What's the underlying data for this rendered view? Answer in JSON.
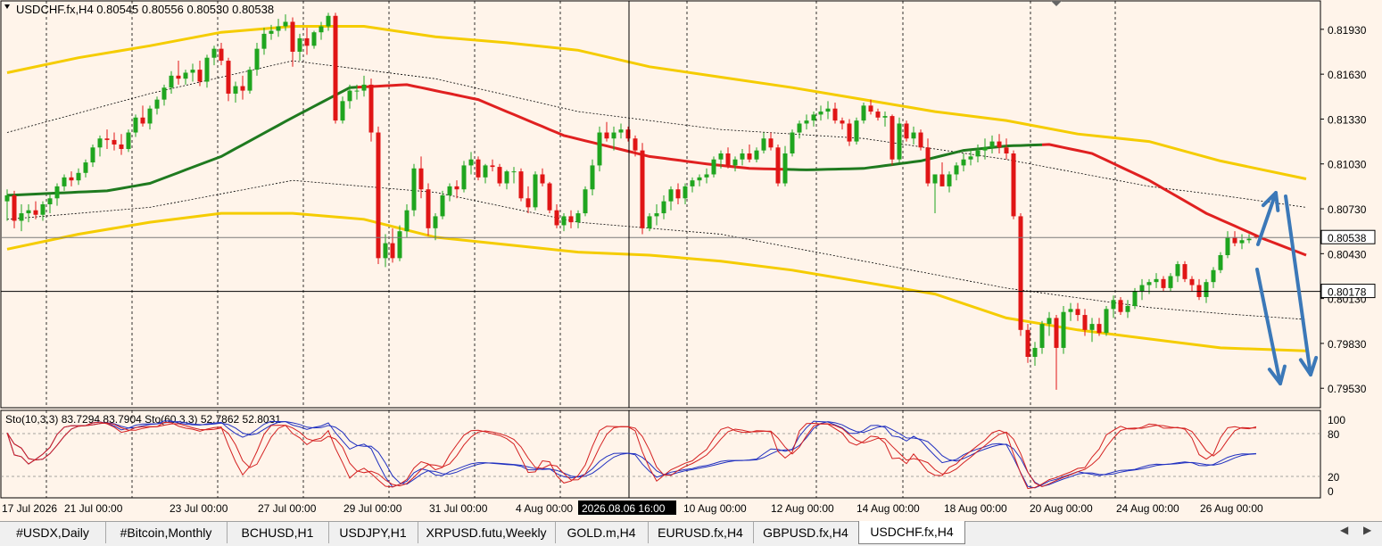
{
  "chart_data": {
    "type": "candlestick",
    "symbol_line": "USDCHF.fx,H4  0.80545 0.80556 0.80530 0.80538",
    "y_ticks": [
      "0.81930",
      "0.81630",
      "0.81330",
      "0.81030",
      "0.80730",
      "0.80430",
      "0.80130",
      "0.79830",
      "0.79530"
    ],
    "current_price_label": "0.80538",
    "crosshair_price_label": "0.80178",
    "x_ticks": [
      "17 Jul 2026",
      "21 Jul 00:00",
      "23 Jul 00:00",
      "27 Jul 00:00",
      "29 Jul 00:00",
      "31 Jul 00:00",
      "4 Aug 00:00",
      "10 Aug 00:00",
      "12 Aug 00:00",
      "14 Aug 00:00",
      "18 Aug 00:00",
      "20 Aug 00:00",
      "24 Aug 00:00",
      "26 Aug 00:00"
    ],
    "crosshair_time_label": "2026.08.06 16:00",
    "indicator_label": "Sto(10,3,3) 83.7294 83.7904  Sto(60,3,3) 52.7862 52.8031",
    "indicator_ticks": [
      "100",
      "80",
      "20",
      "0"
    ],
    "grid": true,
    "candles": [
      [
        0.8078,
        0.8086,
        0.8065,
        0.8082
      ],
      [
        0.8082,
        0.8085,
        0.806,
        0.8065
      ],
      [
        0.8065,
        0.8076,
        0.8058,
        0.807
      ],
      [
        0.807,
        0.8076,
        0.8064,
        0.8072
      ],
      [
        0.8072,
        0.8078,
        0.8066,
        0.8069
      ],
      [
        0.8069,
        0.8078,
        0.8065,
        0.8076
      ],
      [
        0.8076,
        0.8083,
        0.807,
        0.808
      ],
      [
        0.808,
        0.809,
        0.8075,
        0.8088
      ],
      [
        0.8088,
        0.8096,
        0.8085,
        0.8094
      ],
      [
        0.8094,
        0.8098,
        0.8088,
        0.8092
      ],
      [
        0.8092,
        0.81,
        0.8089,
        0.8097
      ],
      [
        0.8097,
        0.8106,
        0.8094,
        0.8104
      ],
      [
        0.8104,
        0.8116,
        0.8101,
        0.8114
      ],
      [
        0.8114,
        0.8122,
        0.8108,
        0.812
      ],
      [
        0.812,
        0.8126,
        0.8113,
        0.8119
      ],
      [
        0.8119,
        0.8124,
        0.8112,
        0.8116
      ],
      [
        0.8116,
        0.8123,
        0.8109,
        0.8113
      ],
      [
        0.8113,
        0.8126,
        0.8111,
        0.8124
      ],
      [
        0.8124,
        0.8136,
        0.8121,
        0.8134
      ],
      [
        0.8134,
        0.8142,
        0.8128,
        0.813
      ],
      [
        0.813,
        0.8142,
        0.8126,
        0.814
      ],
      [
        0.814,
        0.8148,
        0.8136,
        0.8146
      ],
      [
        0.8146,
        0.8156,
        0.8142,
        0.8154
      ],
      [
        0.8154,
        0.8165,
        0.815,
        0.8162
      ],
      [
        0.8162,
        0.8172,
        0.8156,
        0.816
      ],
      [
        0.816,
        0.8166,
        0.8156,
        0.8164
      ],
      [
        0.8164,
        0.817,
        0.8158,
        0.8166
      ],
      [
        0.8166,
        0.8172,
        0.8155,
        0.8158
      ],
      [
        0.8158,
        0.8176,
        0.8154,
        0.8174
      ],
      [
        0.8174,
        0.8182,
        0.8169,
        0.818
      ],
      [
        0.818,
        0.8184,
        0.8169,
        0.8172
      ],
      [
        0.8172,
        0.8174,
        0.8145,
        0.815
      ],
      [
        0.815,
        0.8158,
        0.8144,
        0.8155
      ],
      [
        0.8155,
        0.8162,
        0.8146,
        0.8152
      ],
      [
        0.8152,
        0.8168,
        0.815,
        0.8166
      ],
      [
        0.8166,
        0.8184,
        0.8162,
        0.818
      ],
      [
        0.818,
        0.8194,
        0.8176,
        0.819
      ],
      [
        0.819,
        0.8196,
        0.8186,
        0.8192
      ],
      [
        0.8192,
        0.82,
        0.8188,
        0.8195
      ],
      [
        0.8195,
        0.8203,
        0.8192,
        0.8198
      ],
      [
        0.8198,
        0.8201,
        0.8168,
        0.8178
      ],
      [
        0.8178,
        0.819,
        0.8172,
        0.8187
      ],
      [
        0.8187,
        0.8194,
        0.8176,
        0.8182
      ],
      [
        0.8182,
        0.8192,
        0.818,
        0.8191
      ],
      [
        0.8191,
        0.8198,
        0.8186,
        0.8195
      ],
      [
        0.8195,
        0.8204,
        0.8192,
        0.8202
      ],
      [
        0.8202,
        0.8204,
        0.813,
        0.8132
      ],
      [
        0.8132,
        0.8148,
        0.813,
        0.8145
      ],
      [
        0.8145,
        0.8156,
        0.814,
        0.8152
      ],
      [
        0.8152,
        0.8156,
        0.8146,
        0.8152
      ],
      [
        0.8152,
        0.8162,
        0.8148,
        0.8156
      ],
      [
        0.8156,
        0.816,
        0.8118,
        0.8124
      ],
      [
        0.8124,
        0.8128,
        0.8036,
        0.804
      ],
      [
        0.804,
        0.8056,
        0.8034,
        0.805
      ],
      [
        0.805,
        0.806,
        0.8037,
        0.804
      ],
      [
        0.804,
        0.8062,
        0.8038,
        0.8058
      ],
      [
        0.8058,
        0.8076,
        0.8054,
        0.8072
      ],
      [
        0.8072,
        0.8103,
        0.8068,
        0.81
      ],
      [
        0.81,
        0.8108,
        0.808,
        0.8086
      ],
      [
        0.8086,
        0.809,
        0.8055,
        0.806
      ],
      [
        0.806,
        0.807,
        0.8052,
        0.8068
      ],
      [
        0.8068,
        0.8085,
        0.8066,
        0.8082
      ],
      [
        0.8082,
        0.809,
        0.8078,
        0.8088
      ],
      [
        0.8088,
        0.8092,
        0.808,
        0.8086
      ],
      [
        0.8086,
        0.8105,
        0.8084,
        0.8102
      ],
      [
        0.8102,
        0.8111,
        0.8096,
        0.8106
      ],
      [
        0.8106,
        0.8108,
        0.8092,
        0.8094
      ],
      [
        0.8094,
        0.8103,
        0.809,
        0.8102
      ],
      [
        0.8102,
        0.8106,
        0.8098,
        0.8101
      ],
      [
        0.8101,
        0.8103,
        0.8088,
        0.809
      ],
      [
        0.809,
        0.8099,
        0.8086,
        0.8098
      ],
      [
        0.8098,
        0.8101,
        0.809,
        0.8098
      ],
      [
        0.8098,
        0.81,
        0.8078,
        0.808
      ],
      [
        0.808,
        0.8088,
        0.807,
        0.8074
      ],
      [
        0.8074,
        0.8098,
        0.8072,
        0.8096
      ],
      [
        0.8096,
        0.81,
        0.8088,
        0.809
      ],
      [
        0.809,
        0.8091,
        0.807,
        0.8072
      ],
      [
        0.8072,
        0.8076,
        0.806,
        0.8062
      ],
      [
        0.8062,
        0.807,
        0.8058,
        0.8068
      ],
      [
        0.8068,
        0.8072,
        0.806,
        0.8064
      ],
      [
        0.8064,
        0.8072,
        0.806,
        0.807
      ],
      [
        0.807,
        0.8088,
        0.8068,
        0.8086
      ],
      [
        0.8086,
        0.8106,
        0.8082,
        0.8102
      ],
      [
        0.8102,
        0.8128,
        0.8098,
        0.8124
      ],
      [
        0.8124,
        0.8131,
        0.8118,
        0.812
      ],
      [
        0.812,
        0.8128,
        0.8112,
        0.8124
      ],
      [
        0.8124,
        0.813,
        0.812,
        0.8126
      ],
      [
        0.8126,
        0.8128,
        0.8118,
        0.812
      ],
      [
        0.812,
        0.8122,
        0.8108,
        0.8112
      ],
      [
        0.8112,
        0.8117,
        0.8056,
        0.806
      ],
      [
        0.806,
        0.807,
        0.8058,
        0.8068
      ],
      [
        0.8068,
        0.8076,
        0.8062,
        0.807
      ],
      [
        0.807,
        0.8082,
        0.8066,
        0.8078
      ],
      [
        0.8078,
        0.8088,
        0.8072,
        0.8086
      ],
      [
        0.8086,
        0.809,
        0.8076,
        0.808
      ],
      [
        0.808,
        0.809,
        0.8076,
        0.8088
      ],
      [
        0.8088,
        0.8094,
        0.8084,
        0.8092
      ],
      [
        0.8092,
        0.8096,
        0.8088,
        0.8094
      ],
      [
        0.8094,
        0.81,
        0.809,
        0.8096
      ],
      [
        0.8096,
        0.8108,
        0.8094,
        0.8106
      ],
      [
        0.8106,
        0.8112,
        0.81,
        0.811
      ],
      [
        0.811,
        0.8114,
        0.81,
        0.8102
      ],
      [
        0.8102,
        0.8108,
        0.8098,
        0.8106
      ],
      [
        0.8106,
        0.8113,
        0.8102,
        0.811
      ],
      [
        0.811,
        0.8116,
        0.8104,
        0.8106
      ],
      [
        0.8106,
        0.8114,
        0.8104,
        0.8112
      ],
      [
        0.8112,
        0.8124,
        0.811,
        0.812
      ],
      [
        0.812,
        0.8124,
        0.8112,
        0.8114
      ],
      [
        0.8114,
        0.8116,
        0.8088,
        0.809
      ],
      [
        0.809,
        0.8115,
        0.8088,
        0.811
      ],
      [
        0.811,
        0.8126,
        0.8108,
        0.8124
      ],
      [
        0.8124,
        0.8132,
        0.812,
        0.813
      ],
      [
        0.813,
        0.8136,
        0.8126,
        0.8132
      ],
      [
        0.8132,
        0.8138,
        0.8128,
        0.8136
      ],
      [
        0.8136,
        0.8142,
        0.8132,
        0.8138
      ],
      [
        0.8138,
        0.8145,
        0.8133,
        0.814
      ],
      [
        0.814,
        0.8144,
        0.813,
        0.8132
      ],
      [
        0.8132,
        0.8134,
        0.8126,
        0.813
      ],
      [
        0.813,
        0.8133,
        0.8115,
        0.8118
      ],
      [
        0.8118,
        0.8134,
        0.8116,
        0.8132
      ],
      [
        0.8132,
        0.8144,
        0.813,
        0.8142
      ],
      [
        0.8142,
        0.8146,
        0.8136,
        0.8138
      ],
      [
        0.8138,
        0.814,
        0.8132,
        0.8134
      ],
      [
        0.8134,
        0.8138,
        0.8128,
        0.8135
      ],
      [
        0.8135,
        0.8136,
        0.8102,
        0.8106
      ],
      [
        0.8106,
        0.8134,
        0.8104,
        0.813
      ],
      [
        0.813,
        0.8132,
        0.8118,
        0.812
      ],
      [
        0.812,
        0.8128,
        0.8116,
        0.8124
      ],
      [
        0.8124,
        0.8126,
        0.8112,
        0.8114
      ],
      [
        0.8114,
        0.812,
        0.8088,
        0.809
      ],
      [
        0.809,
        0.8096,
        0.807,
        0.8096
      ],
      [
        0.8096,
        0.8104,
        0.8088,
        0.8088
      ],
      [
        0.8088,
        0.8098,
        0.8084,
        0.8096
      ],
      [
        0.8096,
        0.8104,
        0.8092,
        0.8102
      ],
      [
        0.8102,
        0.811,
        0.8098,
        0.8106
      ],
      [
        0.8106,
        0.8112,
        0.8102,
        0.8108
      ],
      [
        0.8108,
        0.8116,
        0.8104,
        0.8112
      ],
      [
        0.8112,
        0.812,
        0.8106,
        0.8114
      ],
      [
        0.8114,
        0.8122,
        0.811,
        0.8118
      ],
      [
        0.8118,
        0.8123,
        0.811,
        0.8114
      ],
      [
        0.8114,
        0.812,
        0.8106,
        0.811
      ],
      [
        0.811,
        0.8112,
        0.8066,
        0.8068
      ],
      [
        0.8068,
        0.807,
        0.7988,
        0.7992
      ],
      [
        0.7992,
        0.7996,
        0.797,
        0.7974
      ],
      [
        0.7974,
        0.7984,
        0.7968,
        0.798
      ],
      [
        0.798,
        0.7998,
        0.7976,
        0.7996
      ],
      [
        0.7996,
        0.8004,
        0.7988,
        0.8
      ],
      [
        0.8,
        0.8002,
        0.7952,
        0.798
      ],
      [
        0.798,
        0.8008,
        0.7976,
        0.8004
      ],
      [
        0.8004,
        0.801,
        0.7998,
        0.8006
      ],
      [
        0.8006,
        0.801,
        0.7998,
        0.8002
      ],
      [
        0.8002,
        0.8006,
        0.7988,
        0.7992
      ],
      [
        0.7992,
        0.8,
        0.7984,
        0.7996
      ],
      [
        0.7996,
        0.8,
        0.7988,
        0.799
      ],
      [
        0.799,
        0.8008,
        0.7988,
        0.8006
      ],
      [
        0.8006,
        0.8015,
        0.8,
        0.8012
      ],
      [
        0.8012,
        0.8014,
        0.8002,
        0.8004
      ],
      [
        0.8004,
        0.8012,
        0.8,
        0.8008
      ],
      [
        0.8008,
        0.802,
        0.8006,
        0.8018
      ],
      [
        0.8018,
        0.8026,
        0.8012,
        0.8022
      ],
      [
        0.8022,
        0.8026,
        0.8016,
        0.8024
      ],
      [
        0.8024,
        0.803,
        0.802,
        0.8026
      ],
      [
        0.8026,
        0.8028,
        0.8018,
        0.802
      ],
      [
        0.802,
        0.803,
        0.8018,
        0.8028
      ],
      [
        0.8028,
        0.8038,
        0.8024,
        0.8036
      ],
      [
        0.8036,
        0.8038,
        0.8024,
        0.8026
      ],
      [
        0.8026,
        0.8028,
        0.8018,
        0.8022
      ],
      [
        0.8022,
        0.8026,
        0.8012,
        0.8014
      ],
      [
        0.8014,
        0.8026,
        0.801,
        0.8024
      ],
      [
        0.8024,
        0.8034,
        0.802,
        0.8032
      ],
      [
        0.8032,
        0.8044,
        0.803,
        0.8042
      ],
      [
        0.8042,
        0.8058,
        0.804,
        0.8054
      ],
      [
        0.8054,
        0.8058,
        0.8048,
        0.805
      ],
      [
        0.805,
        0.8056,
        0.8046,
        0.8052
      ],
      [
        0.8052,
        0.8056,
        0.805,
        0.8053
      ],
      [
        0.80545,
        0.80556,
        0.8053,
        0.80538
      ]
    ],
    "ma_center": [
      [
        0,
        0.8082
      ],
      [
        14,
        0.8085
      ],
      [
        20,
        0.809
      ],
      [
        30,
        0.8108
      ],
      [
        40,
        0.8134
      ],
      [
        48,
        0.8154
      ],
      [
        56,
        0.8156
      ],
      [
        66,
        0.8146
      ],
      [
        78,
        0.8122
      ],
      [
        90,
        0.8108
      ],
      [
        98,
        0.8103
      ],
      [
        104,
        0.81
      ],
      [
        112,
        0.8099
      ],
      [
        120,
        0.81
      ],
      [
        128,
        0.8105
      ],
      [
        134,
        0.8112
      ],
      [
        140,
        0.8115
      ],
      [
        146,
        0.8116
      ],
      [
        152,
        0.811
      ],
      [
        160,
        0.8092
      ],
      [
        168,
        0.807
      ],
      [
        176,
        0.8053
      ],
      [
        182,
        0.8042
      ]
    ],
    "ma_center_colors": [
      [
        "#1F7A1F",
        0,
        49
      ],
      [
        "#E02020",
        49,
        109
      ],
      [
        "#1F7A1F",
        109,
        145
      ],
      [
        "#E02020",
        145,
        182
      ]
    ],
    "band_upper": [
      [
        0,
        0.8164
      ],
      [
        10,
        0.8174
      ],
      [
        20,
        0.8182
      ],
      [
        30,
        0.8191
      ],
      [
        40,
        0.8195
      ],
      [
        50,
        0.8195
      ],
      [
        60,
        0.8188
      ],
      [
        70,
        0.8184
      ],
      [
        80,
        0.8179
      ],
      [
        90,
        0.8168
      ],
      [
        100,
        0.8161
      ],
      [
        110,
        0.8154
      ],
      [
        120,
        0.8146
      ],
      [
        130,
        0.8138
      ],
      [
        140,
        0.8132
      ],
      [
        150,
        0.8123
      ],
      [
        160,
        0.8118
      ],
      [
        170,
        0.8105
      ],
      [
        182,
        0.8093
      ]
    ],
    "band_lower": [
      [
        0,
        0.8046
      ],
      [
        10,
        0.8056
      ],
      [
        20,
        0.8064
      ],
      [
        30,
        0.807
      ],
      [
        40,
        0.807
      ],
      [
        50,
        0.8066
      ],
      [
        60,
        0.8054
      ],
      [
        70,
        0.8049
      ],
      [
        80,
        0.8044
      ],
      [
        90,
        0.8042
      ],
      [
        100,
        0.8038
      ],
      [
        110,
        0.8032
      ],
      [
        120,
        0.8024
      ],
      [
        130,
        0.8016
      ],
      [
        140,
        0.8
      ],
      [
        150,
        0.7992
      ],
      [
        160,
        0.7986
      ],
      [
        170,
        0.798
      ],
      [
        182,
        0.7978
      ]
    ],
    "band_mid_upper": [
      [
        0,
        0.8124
      ],
      [
        20,
        0.815
      ],
      [
        40,
        0.8172
      ],
      [
        60,
        0.816
      ],
      [
        80,
        0.8138
      ],
      [
        100,
        0.8126
      ],
      [
        120,
        0.812
      ],
      [
        140,
        0.8106
      ],
      [
        160,
        0.8088
      ],
      [
        170,
        0.8082
      ],
      [
        182,
        0.8074
      ]
    ],
    "band_mid_lower": [
      [
        0,
        0.8066
      ],
      [
        20,
        0.8074
      ],
      [
        40,
        0.8092
      ],
      [
        60,
        0.8084
      ],
      [
        80,
        0.8064
      ],
      [
        100,
        0.8056
      ],
      [
        120,
        0.8038
      ],
      [
        140,
        0.802
      ],
      [
        160,
        0.8007
      ],
      [
        170,
        0.8003
      ],
      [
        182,
        0.7999
      ]
    ]
  },
  "tabs": [
    "#USDX,Daily",
    "#Bitcoin,Monthly",
    "BCHUSD,H1",
    "USDJPY,H1",
    "XRPUSD.futu,Weekly",
    "GOLD.m,H4",
    "EURUSD.fx,H4",
    "GBPUSD.fx,H4",
    "USDCHF.fx,H4"
  ],
  "active_tab": "USDCHF.fx,H4",
  "colors": {
    "background": "#FFF4EA",
    "bull": "#1FA51F",
    "bear": "#E01515",
    "band": "#F5CC00",
    "ma_up": "#1F7A1F",
    "ma_down": "#E02020",
    "arrow": "#3B78B8",
    "stoch_fast": "#D42020",
    "stoch_slow": "#2030C0"
  }
}
